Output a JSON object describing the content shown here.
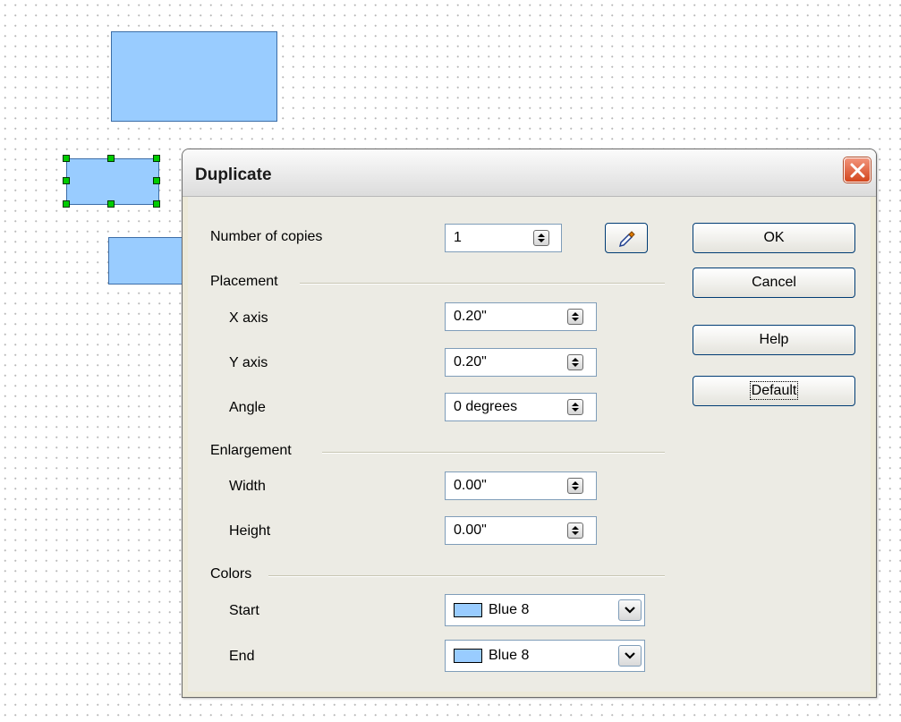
{
  "dialog": {
    "title": "Duplicate",
    "number_of_copies": {
      "label": "Number of copies",
      "value": "1"
    },
    "placement": {
      "title": "Placement",
      "x_axis": {
        "label": "X axis",
        "value": "0.20\""
      },
      "y_axis": {
        "label": "Y axis",
        "value": "0.20\""
      },
      "angle": {
        "label": "Angle",
        "value": "0 degrees"
      }
    },
    "enlargement": {
      "title": "Enlargement",
      "width": {
        "label": "Width",
        "value": "0.00\""
      },
      "height": {
        "label": "Height",
        "value": "0.00\""
      }
    },
    "colors": {
      "title": "Colors",
      "start": {
        "label": "Start",
        "value": "Blue 8"
      },
      "end": {
        "label": "End",
        "value": "Blue 8"
      }
    },
    "buttons": {
      "ok": "OK",
      "cancel": "Cancel",
      "help": "Help",
      "default": "Default"
    }
  },
  "icons": [
    "close-icon",
    "eyedropper-icon",
    "spin-up-down-icon",
    "dropdown-arrow-icon"
  ],
  "colors": {
    "shape_fill": "#99ccff",
    "shape_border": "#3c6ea8",
    "handle": "#00cc00",
    "close_button": "#d3461d"
  }
}
